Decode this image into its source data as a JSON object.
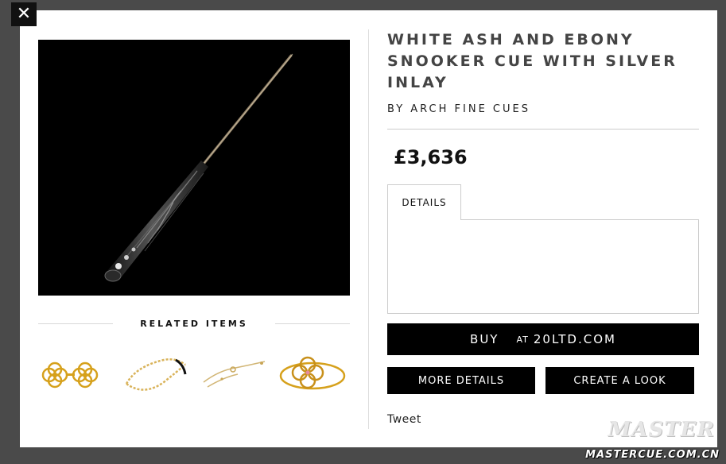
{
  "modal": {
    "close_label": "✕"
  },
  "product": {
    "title": "WHITE ASH AND EBONY SNOOKER CUE WITH SILVER INLAY",
    "brand": "BY ARCH FINE CUES",
    "price": "£3,636",
    "image_icon": "snooker-cue-image"
  },
  "tabs": [
    {
      "label": "DETAILS"
    }
  ],
  "buy": {
    "label": "BUY",
    "at": "AT",
    "store": "20LTD.COM"
  },
  "actions": {
    "more_details": "MORE DETAILS",
    "create_look": "CREATE A LOOK"
  },
  "social": {
    "tweet": "Tweet"
  },
  "related": {
    "title": "RELATED ITEMS",
    "items": [
      {
        "name": "gold-clover-earrings"
      },
      {
        "name": "gold-chain-bracelet"
      },
      {
        "name": "hand-chain-bracelet"
      },
      {
        "name": "gold-clover-ring"
      }
    ]
  },
  "watermark": {
    "logo": "MASTER",
    "url": "MASTERCUE.COM.CN"
  }
}
